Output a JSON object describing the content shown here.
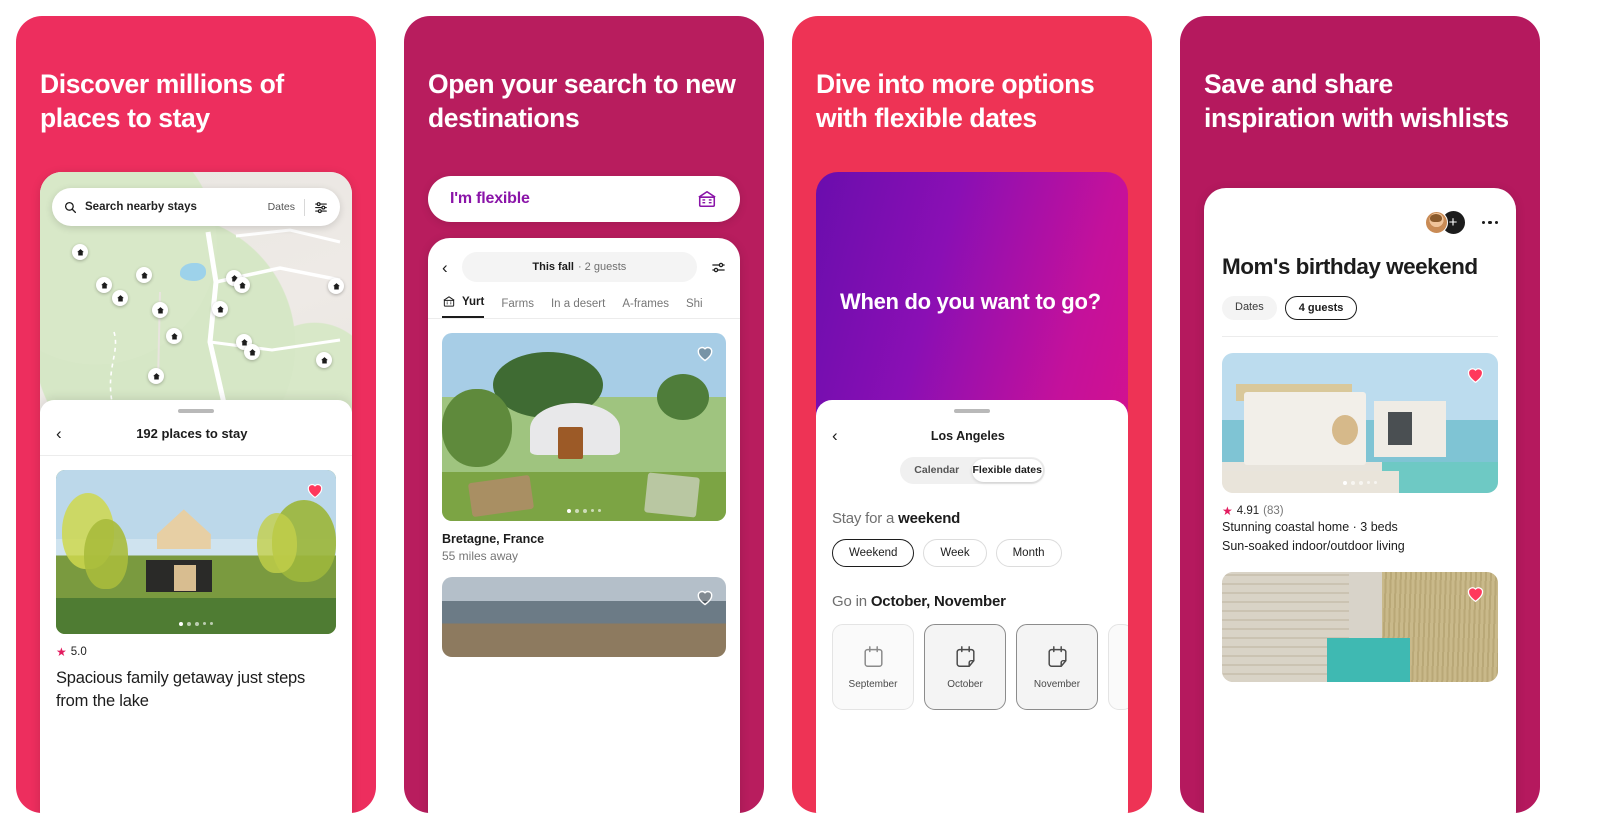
{
  "colors": {
    "panel1_bg": "#ED2E5E",
    "panel2_bg": "#B81D5E",
    "panel3_bg": "#EE3355",
    "panel4_bg": "#B5195E",
    "brand_red": "#E31C5F",
    "flexible_purple": "#8A14A8",
    "gradient_start": "#6A0DAD",
    "gradient_end": "#E5127F"
  },
  "panels": [
    {
      "headline": "Discover millions of places to stay",
      "search": {
        "placeholder": "Search nearby stays",
        "dates_label": "Dates",
        "search_icon": "search-icon",
        "filter_icon": "filter-sliders-icon"
      },
      "map": {
        "pin_icon": "house-pin-icon",
        "pin_count": 16
      },
      "sheet": {
        "back_icon": "chevron-left-icon",
        "title": "192 places to stay",
        "listing": {
          "heart_icon": "heart-filled-icon",
          "rating_star": "star-icon",
          "rating": "5.0",
          "title": "Spacious family getaway just steps from the lake",
          "carousel_dots": 5,
          "carousel_active": 0
        }
      }
    },
    {
      "headline": "Open your search to new destinations",
      "flexible_pill": {
        "label": "I'm flexible",
        "icon": "yurt-icon"
      },
      "topbar": {
        "back_icon": "chevron-left-icon",
        "filter_icon": "filter-sliders-icon",
        "search_summary_bold": "This fall",
        "search_summary_rest": "· 2 guests"
      },
      "categories": [
        {
          "label": "Yurt",
          "icon": "yurt-icon",
          "active": true
        },
        {
          "label": "Farms",
          "active": false
        },
        {
          "label": "In a desert",
          "active": false
        },
        {
          "label": "A-frames",
          "active": false
        },
        {
          "label": "Shi",
          "active": false
        }
      ],
      "listing": {
        "heart_icon": "heart-outline-icon",
        "name": "Bretagne, France",
        "distance": "55 miles away",
        "carousel_dots": 5,
        "carousel_active": 0
      },
      "listing2": {
        "heart_icon": "heart-outline-icon"
      }
    },
    {
      "headline": "Dive into more options with flexible dates",
      "gradient_question": "When do you want to go?",
      "sheet": {
        "back_icon": "chevron-left-icon",
        "title": "Los Angeles",
        "toggle": [
          {
            "label": "Calendar",
            "selected": false
          },
          {
            "label": "Flexible dates",
            "selected": true
          }
        ],
        "stay_label_prefix": "Stay for a",
        "stay_label_value": "weekend",
        "duration_chips": [
          {
            "label": "Weekend",
            "selected": true
          },
          {
            "label": "Week",
            "selected": false
          },
          {
            "label": "Month",
            "selected": false
          }
        ],
        "go_label_prefix": "Go in",
        "go_label_value": "October, November",
        "months": [
          {
            "label": "September",
            "selected": false,
            "icon": "calendar-icon"
          },
          {
            "label": "October",
            "selected": true,
            "icon": "calendar-icon"
          },
          {
            "label": "November",
            "selected": true,
            "icon": "calendar-icon"
          }
        ]
      }
    },
    {
      "headline": "Save and share inspiration with wishlists",
      "header": {
        "avatar_icon": "avatar",
        "add_icon": "plus-icon",
        "more_icon": "more-dots-icon"
      },
      "title": "Mom's birthday weekend",
      "chips": [
        {
          "label": "Dates",
          "selected": false
        },
        {
          "label": "4 guests",
          "selected": true
        }
      ],
      "listings": [
        {
          "heart_icon": "heart-filled-icon",
          "rating_star": "star-icon",
          "rating": "4.91",
          "review_count": "(83)",
          "line1": "Stunning coastal home · 3 beds",
          "line2": "Sun-soaked indoor/outdoor living",
          "carousel_dots": 5,
          "carousel_active": 0
        },
        {
          "heart_icon": "heart-filled-icon"
        }
      ]
    }
  ]
}
